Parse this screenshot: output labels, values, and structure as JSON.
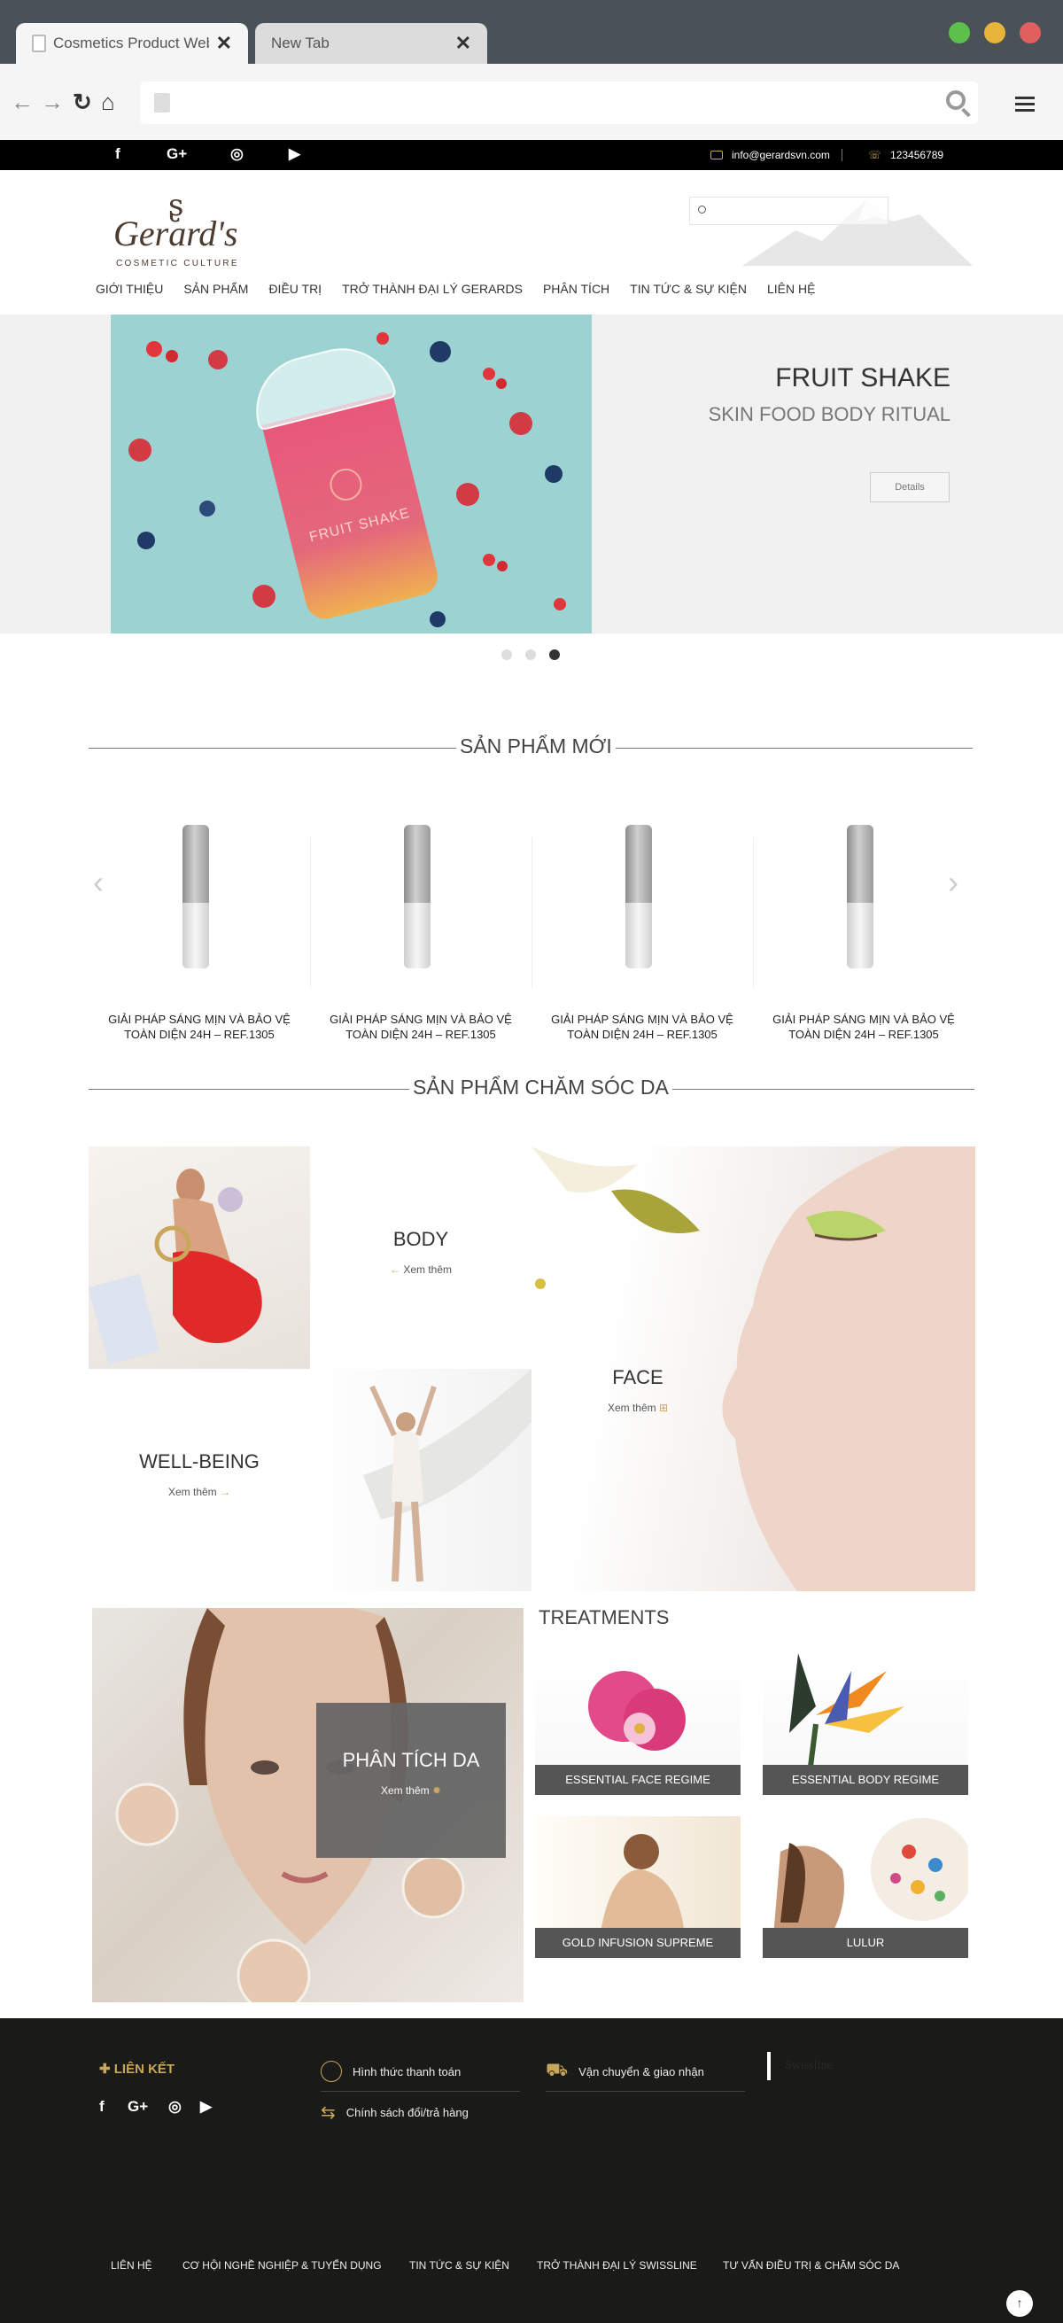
{
  "browser": {
    "tabs": [
      {
        "label": "Cosmetics Product Web..",
        "close": "✕"
      },
      {
        "label": "New Tab",
        "close": "✕"
      }
    ],
    "url": ""
  },
  "topbar": {
    "email": "info@gerardsvn.com",
    "phone": "123456789",
    "social": {
      "facebook": "f",
      "googleplus": "G+",
      "instagram": "◎",
      "youtube": "▶"
    }
  },
  "brand": {
    "mark": "ʂ",
    "name": "Gerard's",
    "tagline": "COSMETIC CULTURE"
  },
  "search": {
    "placeholder": ""
  },
  "nav": [
    "GIỚI THIỆU",
    "SẢN PHẨM",
    "ĐIỀU TRỊ",
    "TRỞ THÀNH ĐẠI LÝ GERARDS",
    "PHÂN TÍCH",
    "TIN TỨC & SỰ KIỆN",
    "LIÊN HỆ"
  ],
  "hero": {
    "title": "FRUIT SHAKE",
    "subtitle": "SKIN FOOD BODY RITUAL",
    "button": "Details",
    "active_slide": 3,
    "slides": 3,
    "cup_text": "FRUIT SHAKE"
  },
  "new_products": {
    "title": "SẢN PHẨM MỚI",
    "items": [
      {
        "line1": "GIẢI PHÁP SÁNG MỊN VÀ BẢO VỆ",
        "line2": "TOÀN DIỆN 24H – REF.1305"
      },
      {
        "line1": "GIẢI PHÁP SÁNG MỊN VÀ BẢO VỆ",
        "line2": "TOÀN DIỆN 24H – REF.1305"
      },
      {
        "line1": "GIẢI PHÁP SÁNG MỊN VÀ BẢO VỆ",
        "line2": "TOÀN DIỆN 24H – REF.1305"
      },
      {
        "line1": "GIẢI PHÁP SÁNG MỊN VÀ BẢO VỆ",
        "line2": "TOÀN DIỆN 24H – REF.1305"
      }
    ]
  },
  "skin_care": {
    "title": "SẢN PHẨM CHĂM SÓC DA",
    "body": {
      "name": "BODY",
      "more": "Xem thêm"
    },
    "face": {
      "name": "FACE",
      "more": "Xem thêm"
    },
    "wellbeing": {
      "name": "WELL-BEING",
      "more": "Xem thêm"
    }
  },
  "analysis": {
    "title": "PHÂN TÍCH DA",
    "more": "Xem thêm"
  },
  "treatments": {
    "title": "TREATMENTS",
    "items": [
      "ESSENTIAL FACE REGIME",
      "ESSENTIAL BODY REGIME",
      "GOLD INFUSION SUPREME",
      "LULUR"
    ]
  },
  "footer": {
    "links_title": "LIÊN KẾT",
    "payment": "Hình thức thanh toán",
    "shipping": "Vận chuyển & giao nhận",
    "returns": "Chính sách đổi/trả hàng",
    "swissline": "Swissline",
    "bottom": [
      "LIÊN HỆ",
      "CƠ HỘI NGHỀ NGHIỆP & TUYỂN DỤNG",
      "TIN TỨC & SỰ KIỆN",
      "TRỞ THÀNH ĐẠI LÝ SWISSLINE",
      "TƯ VẤN ĐIỀU TRỊ & CHĂM SÓC DA"
    ],
    "to_top": "↑"
  },
  "colors": {
    "accent": "#c9a75a",
    "brand": "#4b3b31",
    "footer_bg": "#1a1a18"
  }
}
